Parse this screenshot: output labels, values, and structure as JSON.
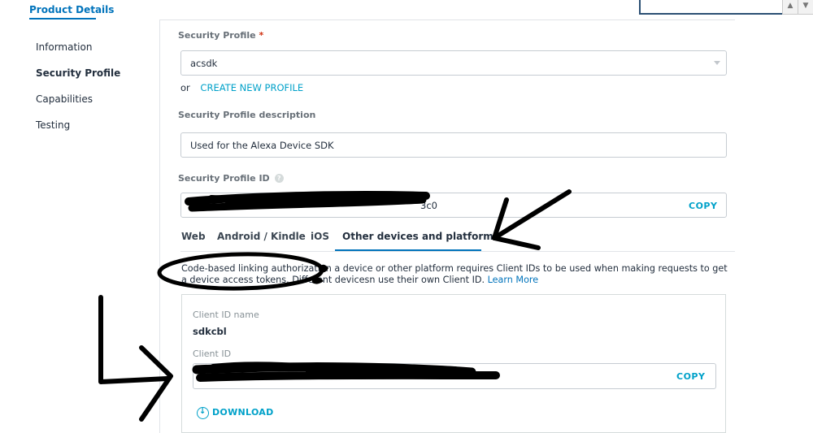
{
  "header": {
    "tab_label": "Product Details"
  },
  "sidebar": {
    "items": [
      {
        "label": "Information"
      },
      {
        "label": "Security Profile"
      },
      {
        "label": "Capabilities"
      },
      {
        "label": "Testing"
      }
    ]
  },
  "security_profile": {
    "label": "Security Profile",
    "required_mark": "*",
    "selected": "acsdk",
    "or_text": "or",
    "create_link": "CREATE NEW PROFILE",
    "description_label": "Security Profile description",
    "description_value": "Used for the Alexa Device SDK",
    "id_label": "Security Profile ID",
    "id_value_visible": "3c0",
    "copy_label": "COPY"
  },
  "platform_tabs": [
    {
      "label": "Web"
    },
    {
      "label": "Android / Kindle"
    },
    {
      "label": "iOS"
    },
    {
      "label": "Other devices and platforms"
    }
  ],
  "platform_panel": {
    "description_part1": "Code-based linking authorization",
    "description_part2": " a device or other platform requires Client IDs to be used when making requests to get a device access tokens. Different devices",
    "description_part3": "n use their own Client ID. ",
    "learn_more": "Learn More",
    "client_id_name_label": "Client ID name",
    "client_id_name_value": "sdkcbl",
    "client_id_label": "Client ID",
    "client_copy_label": "COPY",
    "download_label": "DOWNLOAD"
  },
  "colors": {
    "accent": "#0073bb",
    "link": "#00a1c9",
    "text": "#232f3e",
    "muted": "#687078",
    "annotation": "#000000"
  },
  "icons": {
    "info": "info-icon",
    "download": "download-icon",
    "dropdown": "chevron-down-icon"
  }
}
